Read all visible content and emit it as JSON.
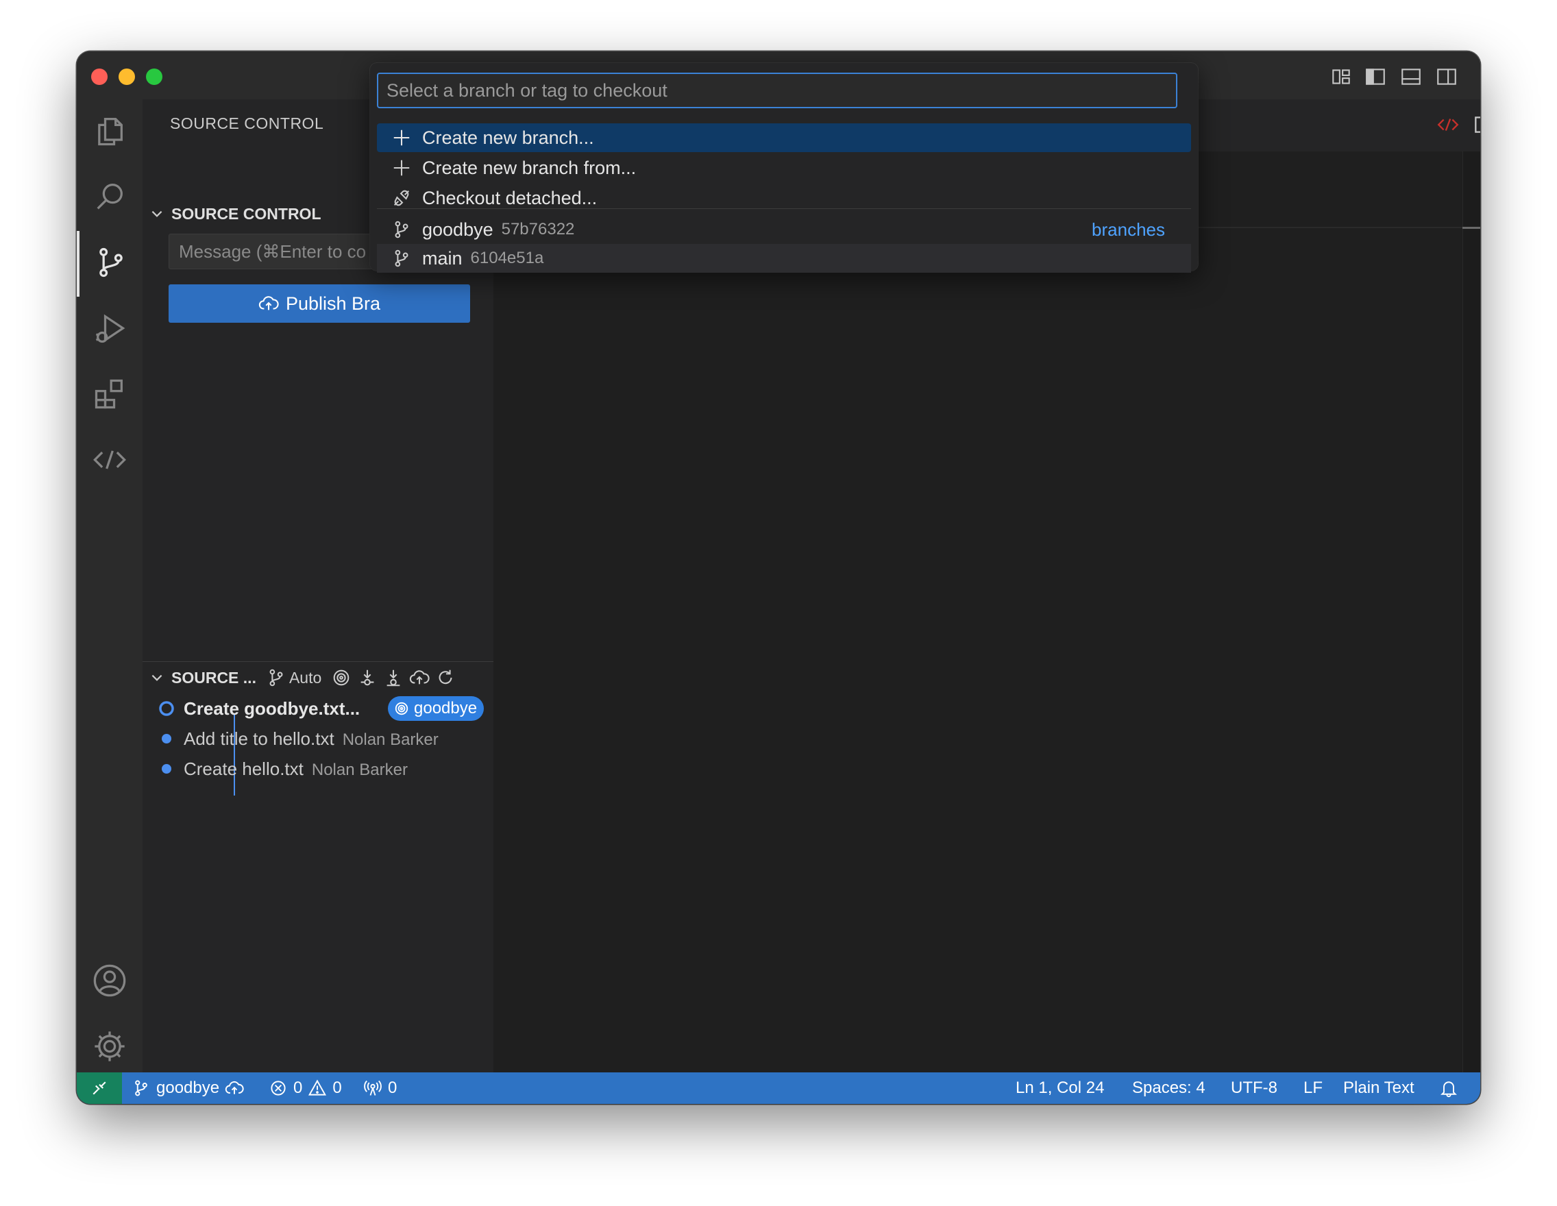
{
  "sidebar": {
    "view_title": "SOURCE CONTROL",
    "section_title": "SOURCE CONTROL",
    "message_placeholder": "Message (⌘Enter to co",
    "publish_label": "Publish Bra"
  },
  "graph": {
    "section_title": "SOURCE ...",
    "auto_label": "Auto",
    "commits": [
      {
        "title": "Create goodbye.txt...",
        "author": "",
        "badge": "goodbye"
      },
      {
        "title": "Add title to hello.txt",
        "author": "Nolan Barker"
      },
      {
        "title": "Create hello.txt",
        "author": "Nolan Barker"
      }
    ]
  },
  "quick_pick": {
    "placeholder": "Select a branch or tag to checkout",
    "items": [
      {
        "label": "Create new branch...",
        "detail": ""
      },
      {
        "label": "Create new branch from...",
        "detail": ""
      },
      {
        "label": "Checkout detached...",
        "detail": ""
      },
      {
        "label": "goodbye",
        "detail": "57b76322",
        "category": "branches"
      },
      {
        "label": "main",
        "detail": "6104e51a"
      }
    ]
  },
  "statusbar": {
    "branch": "goodbye",
    "errors": "0",
    "warnings": "0",
    "ports": "0",
    "position": "Ln 1, Col 24",
    "spaces": "Spaces: 4",
    "encoding": "UTF-8",
    "eol": "LF",
    "language": "Plain Text"
  },
  "colors": {
    "accent": "#2e73c4",
    "remote": "#16825d",
    "badge": "#2f7fe0",
    "selection": "#0f3a66"
  },
  "icons": [
    "files-icon",
    "search-icon",
    "source-control-icon",
    "run-debug-icon",
    "extensions-icon",
    "remote-explorer-icon",
    "account-icon",
    "settings-gear-icon"
  ]
}
